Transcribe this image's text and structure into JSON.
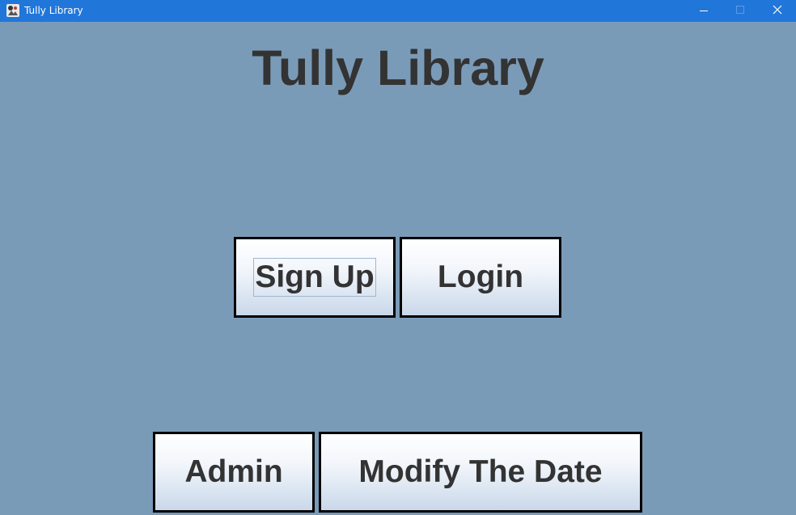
{
  "window": {
    "title": "Tully Library",
    "controls": {
      "minimize_icon": "minimize-icon",
      "maximize_icon": "maximize-icon",
      "close_icon": "close-icon"
    },
    "titlebar_color": "#2176d9",
    "background_color": "#7a9bb8"
  },
  "main": {
    "heading": "Tully Library",
    "buttons": {
      "sign_up": "Sign Up",
      "login": "Login",
      "admin": "Admin",
      "modify_date": "Modify The Date"
    },
    "focused_button": "Sign Up"
  }
}
